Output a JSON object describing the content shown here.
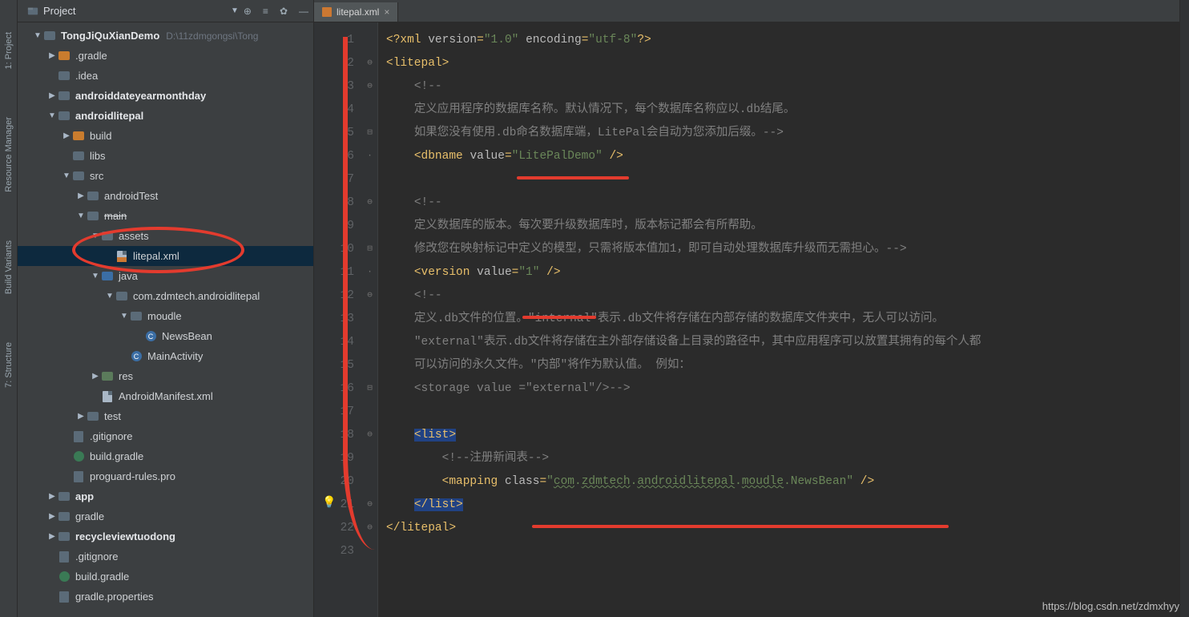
{
  "leftTabs": [
    "1: Project",
    "Resource Manager",
    "Build Variants",
    "7: Structure"
  ],
  "projectPanel": {
    "title": "Project",
    "tree": [
      {
        "d": 0,
        "a": "▼",
        "i": "folder",
        "label": "TongJiQuXianDemo",
        "bold": true,
        "hint": "D:\\11zdmgongsi\\Tong"
      },
      {
        "d": 1,
        "a": "▶",
        "i": "folder or",
        "label": ".gradle"
      },
      {
        "d": 1,
        "a": "",
        "i": "folder",
        "label": ".idea"
      },
      {
        "d": 1,
        "a": "▶",
        "i": "folder",
        "label": "androiddateyearmonthday",
        "bold": true
      },
      {
        "d": 1,
        "a": "▼",
        "i": "folder",
        "label": "androidlitepal",
        "bold": true
      },
      {
        "d": 2,
        "a": "▶",
        "i": "folder or",
        "label": "build"
      },
      {
        "d": 2,
        "a": "",
        "i": "folder",
        "label": "libs"
      },
      {
        "d": 2,
        "a": "▼",
        "i": "folder",
        "label": "src"
      },
      {
        "d": 3,
        "a": "▶",
        "i": "folder",
        "label": "androidTest"
      },
      {
        "d": 3,
        "a": "▼",
        "i": "folder",
        "label": "main",
        "struck": true
      },
      {
        "d": 4,
        "a": "▼",
        "i": "folder",
        "label": "assets"
      },
      {
        "d": 5,
        "a": "",
        "i": "xml or",
        "label": "litepal.xml",
        "sel": true
      },
      {
        "d": 4,
        "a": "▼",
        "i": "folder bl",
        "label": "java"
      },
      {
        "d": 5,
        "a": "▼",
        "i": "folder",
        "label": "com.zdmtech.androidlitepal"
      },
      {
        "d": 6,
        "a": "▼",
        "i": "folder",
        "label": "moudle"
      },
      {
        "d": 7,
        "a": "",
        "i": "class",
        "label": "NewsBean"
      },
      {
        "d": 6,
        "a": "",
        "i": "class",
        "label": "MainActivity"
      },
      {
        "d": 4,
        "a": "▶",
        "i": "folder gr",
        "label": "res"
      },
      {
        "d": 4,
        "a": "",
        "i": "xml",
        "label": "AndroidManifest.xml"
      },
      {
        "d": 3,
        "a": "▶",
        "i": "folder",
        "label": "test"
      },
      {
        "d": 2,
        "a": "",
        "i": "txt",
        "label": ".gitignore"
      },
      {
        "d": 2,
        "a": "",
        "i": "gradle",
        "label": "build.gradle"
      },
      {
        "d": 2,
        "a": "",
        "i": "txt",
        "label": "proguard-rules.pro"
      },
      {
        "d": 1,
        "a": "▶",
        "i": "folder",
        "label": "app",
        "bold": true
      },
      {
        "d": 1,
        "a": "▶",
        "i": "folder",
        "label": "gradle"
      },
      {
        "d": 1,
        "a": "▶",
        "i": "folder",
        "label": "recycleviewtuodong",
        "bold": true
      },
      {
        "d": 1,
        "a": "",
        "i": "txt",
        "label": ".gitignore"
      },
      {
        "d": 1,
        "a": "",
        "i": "gradle",
        "label": "build.gradle"
      },
      {
        "d": 1,
        "a": "",
        "i": "txt",
        "label": "gradle.properties"
      }
    ]
  },
  "editor": {
    "tabName": "litepal.xml",
    "lineCount": 23,
    "lines": [
      {
        "n": 1,
        "html": "<span class='pi'>&lt;?</span><span class='tagb'>xml </span><span class='attr'>version</span><span class='tagb'>=</span><span class='str'>\"1.0\"</span> <span class='attr'>encoding</span><span class='tagb'>=</span><span class='str'>\"utf-8\"</span><span class='pi'>?&gt;</span>"
      },
      {
        "n": 2,
        "html": "<span class='tagb'>&lt;litepal&gt;</span>"
      },
      {
        "n": 3,
        "html": "    <span class='cmt'>&lt;!--</span>"
      },
      {
        "n": 4,
        "html": "    <span class='cmt'>定义应用程序的数据库名称。默认情况下，每个数据库名称应以.db结尾。</span>"
      },
      {
        "n": 5,
        "html": "    <span class='cmt'>如果您没有使用.db命名数据库端，LitePal会自动为您添加后缀。--&gt;</span>"
      },
      {
        "n": 6,
        "html": "    <span class='tagb'>&lt;dbname </span><span class='attr'>value</span><span class='tagb'>=</span><span class='str'>\"LitePalDemo\"</span> <span class='tagb'>/&gt;</span>"
      },
      {
        "n": 7,
        "html": ""
      },
      {
        "n": 8,
        "html": "    <span class='cmt'>&lt;!--</span>"
      },
      {
        "n": 9,
        "html": "    <span class='cmt'>定义数据库的版本。每次要升级数据库时，版本标记都会有所帮助。</span>"
      },
      {
        "n": 10,
        "html": "    <span class='cmt'>修改您在映射标记中定义的模型，只需将版本值加1，即可自动处理数据库升级而无需担心。--&gt;</span>"
      },
      {
        "n": 11,
        "html": "    <span class='tagb'>&lt;version </span><span class='attr'>value</span><span class='tagb'>=</span><span class='str'>\"1\"</span> <span class='tagb'>/&gt;</span>"
      },
      {
        "n": 12,
        "html": "    <span class='cmt'>&lt;!--</span>"
      },
      {
        "n": 13,
        "html": "    <span class='cmt'>定义.db文件的位置。\"internal\"表示.db文件将存储在内部存储的数据库文件夹中，无人可以访问。</span>"
      },
      {
        "n": 14,
        "html": "    <span class='cmt'>\"external\"表示.db文件将存储在主外部存储设备上目录的路径中，其中应用程序可以放置其拥有的每个人都</span>"
      },
      {
        "n": 15,
        "html": "    <span class='cmt'>可以访问的永久文件。\"内部\"将作为默认值。 例如：</span>"
      },
      {
        "n": 16,
        "html": "    <span class='cmt'>&lt;storage value =\"external\"/&gt;--&gt;</span>"
      },
      {
        "n": 17,
        "html": ""
      },
      {
        "n": 18,
        "html": "    <span class='hlbg'><span class='tagb'>&lt;list&gt;</span></span>"
      },
      {
        "n": 19,
        "html": "        <span class='cmt'>&lt;!--注册新闻表--&gt;</span>"
      },
      {
        "n": 20,
        "html": "        <span class='tagb'>&lt;mapping </span><span class='attr'>class</span><span class='tagb'>=</span><span class='str'>\"<span class='wavy'>com</span>.<span class='wavy'>zdmtech</span>.<span class='wavy'>androidlitepal</span>.<span class='wavy'>moudle</span>.NewsBean\"</span> <span class='tagb'>/&gt;</span>"
      },
      {
        "n": 21,
        "html": "    <span class='hlbg'><span class='tagb'>&lt;/list&gt;</span></span>"
      },
      {
        "n": 22,
        "html": "<span class='tagb'>&lt;/litepal&gt;</span>"
      },
      {
        "n": 23,
        "html": ""
      }
    ]
  },
  "watermark": "https://blog.csdn.net/zdmxhyy"
}
